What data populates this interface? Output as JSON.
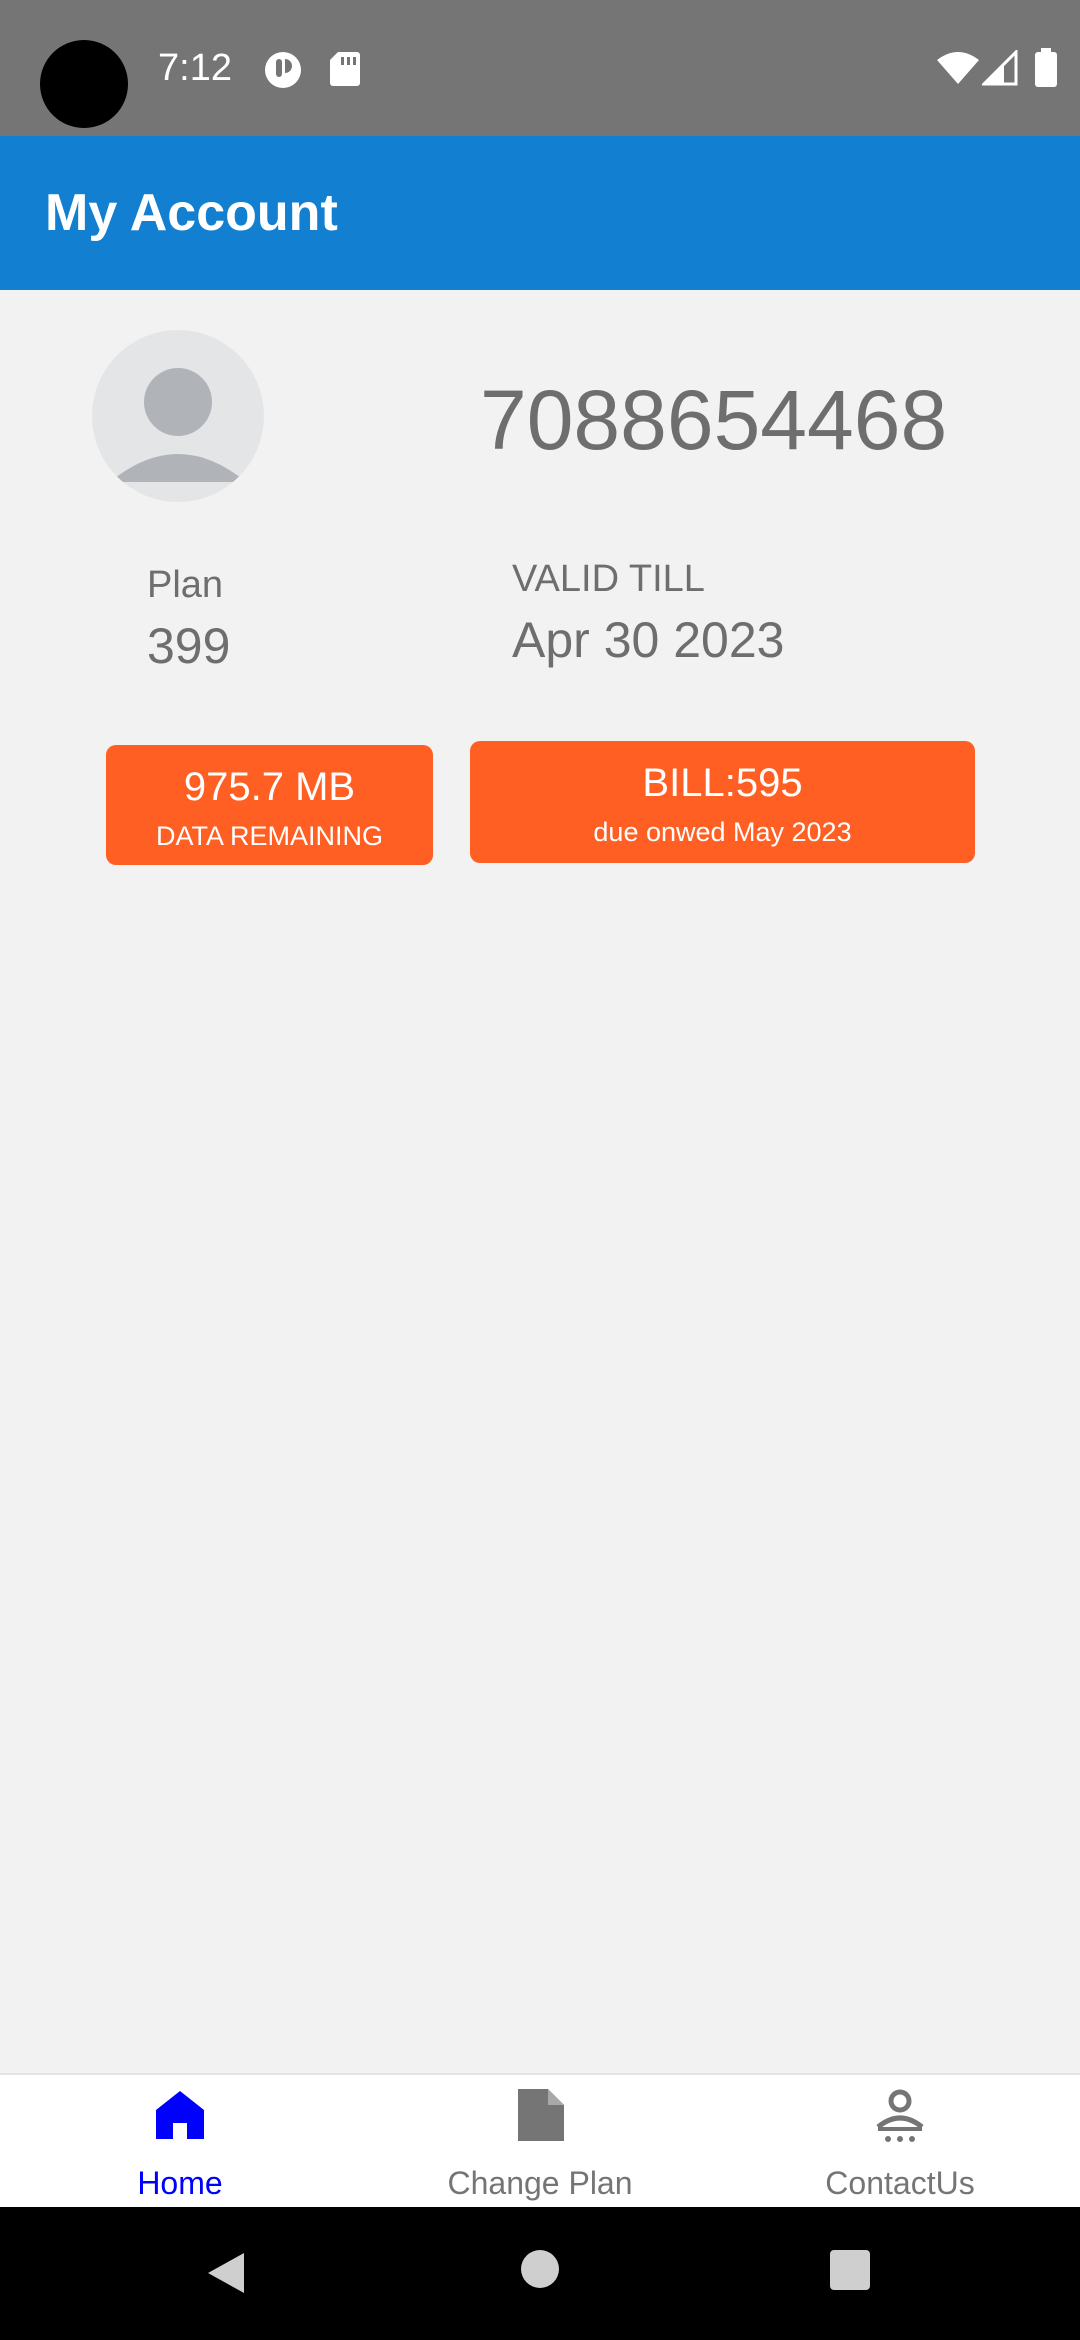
{
  "status_bar": {
    "time": "7:12",
    "icons": [
      "camera-cutout",
      "notification-badge-icon",
      "sd-card-icon",
      "wifi-icon",
      "cellular-signal-icon",
      "battery-icon"
    ]
  },
  "app_bar": {
    "title": "My Account"
  },
  "account": {
    "avatar_icon": "person-icon",
    "phone_number": "7088654468",
    "plan_label": "Plan",
    "plan_value": "399",
    "valid_label": "VALID TILL",
    "valid_value": "Apr 30 2023"
  },
  "data_card": {
    "amount": "975.7 MB",
    "caption": "DATA REMAINING"
  },
  "bill_card": {
    "amount": "BILL:595",
    "caption": "due onwed May 2023"
  },
  "bottom_nav": {
    "items": [
      {
        "label": "Home",
        "icon": "home-icon",
        "active": true
      },
      {
        "label": "Change Plan",
        "icon": "document-icon",
        "active": false
      },
      {
        "label": "ContactUs",
        "icon": "contact-person-icon",
        "active": false
      }
    ]
  },
  "system_nav": {
    "buttons": [
      "back-icon",
      "home-circle-icon",
      "recents-icon"
    ]
  },
  "colors": {
    "status_bar": "#757575",
    "app_bar": "#127fd0",
    "accent_orange": "#ff5f22",
    "background": "#f2f2f2",
    "nav_active": "#0000ff",
    "nav_inactive": "#757575",
    "text_gray": "#6e6e6e"
  }
}
